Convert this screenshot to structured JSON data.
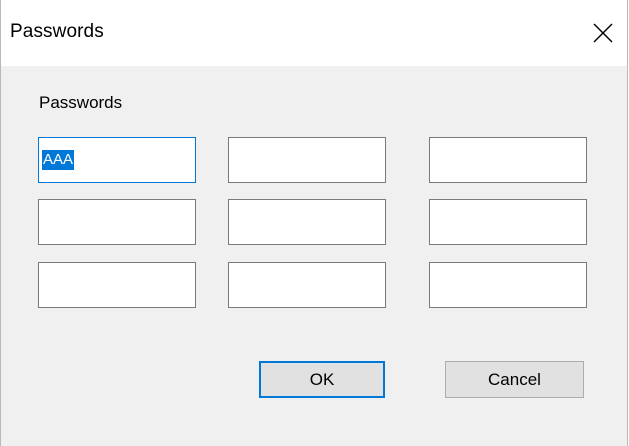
{
  "window": {
    "title": "Passwords",
    "close_glyph": "close-icon"
  },
  "group": {
    "label": "Passwords"
  },
  "fields": [
    {
      "value": "AAA",
      "focused": true,
      "selected": true
    },
    {
      "value": ""
    },
    {
      "value": ""
    },
    {
      "value": ""
    },
    {
      "value": ""
    },
    {
      "value": ""
    },
    {
      "value": ""
    },
    {
      "value": ""
    },
    {
      "value": ""
    }
  ],
  "buttons": {
    "ok_label": "OK",
    "cancel_label": "Cancel"
  },
  "colors": {
    "accent": "#0078d7",
    "dialog_bg": "#f0f0f0",
    "button_bg": "#e1e1e1"
  }
}
